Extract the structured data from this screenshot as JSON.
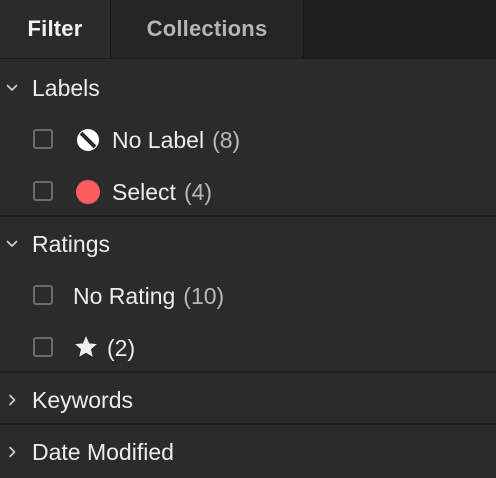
{
  "tabs": {
    "filter": "Filter",
    "collections": "Collections"
  },
  "sections": {
    "labels": {
      "title": "Labels",
      "expanded": true,
      "items": [
        {
          "label": "No Label",
          "count": "(8)",
          "icon": "no-label-icon"
        },
        {
          "label": "Select",
          "count": "(4)",
          "icon": "red-dot-icon",
          "color": "#ff5a5f"
        }
      ]
    },
    "ratings": {
      "title": "Ratings",
      "expanded": true,
      "items": [
        {
          "label": "No Rating",
          "count": "(10)"
        },
        {
          "label": "",
          "count": "(2)",
          "icon": "star-icon"
        }
      ]
    },
    "keywords": {
      "title": "Keywords",
      "expanded": false
    },
    "date_modified": {
      "title": "Date Modified",
      "expanded": false
    }
  },
  "colors": {
    "background": "#2b2b2b",
    "tabbar": "#1f1f1f",
    "select_label": "#ff5a5f"
  }
}
